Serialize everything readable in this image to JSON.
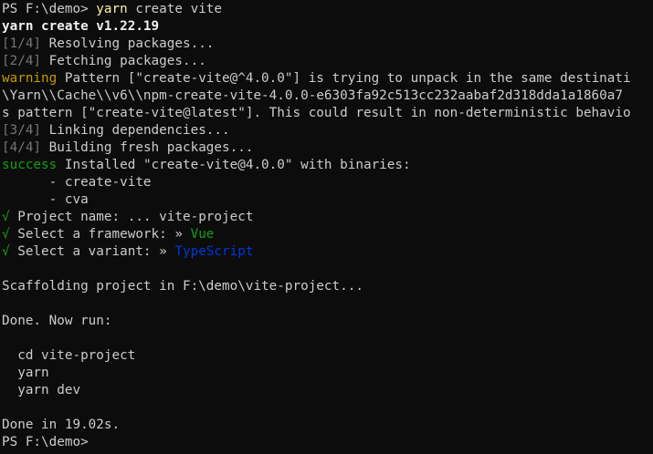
{
  "terminal": {
    "prompt": "PS F:\\demo>",
    "command": {
      "program": "yarn",
      "args": " create vite"
    },
    "yarn_version_line": "yarn create v1.22.19",
    "steps": {
      "resolving": {
        "tag": "[1/4]",
        "text": " Resolving packages..."
      },
      "fetching": {
        "tag": "[2/4]",
        "text": " Fetching packages..."
      },
      "linking": {
        "tag": "[3/4]",
        "text": " Linking dependencies..."
      },
      "building": {
        "tag": "[4/4]",
        "text": " Building fresh packages..."
      }
    },
    "warning": {
      "label": "warning",
      "line1": " Pattern [\"create-vite@^4.0.0\"] is trying to unpack in the same destinati",
      "line2": "\\Yarn\\\\Cache\\\\v6\\\\npm-create-vite-4.0.0-e6303fa92c513cc232aabaf2d318dda1a1860a7",
      "line3": "s pattern [\"create-vite@latest\"]. This could result in non-deterministic behavio"
    },
    "success": {
      "label": "success",
      "text": " Installed \"create-vite@4.0.0\" with binaries:",
      "binaries": [
        "      - create-vite",
        "      - cva"
      ]
    },
    "prompts": {
      "check": "√",
      "project_name": {
        "label": " Project name: ... ",
        "value": "vite-project"
      },
      "framework": {
        "label": " Select a framework: » ",
        "value": "Vue"
      },
      "variant": {
        "label": " Select a variant: » ",
        "value": "TypeScript"
      }
    },
    "scaffolding": "Scaffolding project in F:\\demo\\vite-project...",
    "done_now_run": "Done. Now run:",
    "next_commands": [
      "  cd vite-project",
      "  yarn",
      "  yarn dev"
    ],
    "done_time": "Done in 19.02s.",
    "final_prompt": "PS F:\\demo>"
  },
  "colors": {
    "background": "#0c0c0c",
    "foreground": "#cccccc",
    "command_highlight": "#f9f1a5",
    "warning": "#c19c00",
    "dim": "#767676",
    "success": "#13a10e",
    "typescript": "#0037da"
  }
}
